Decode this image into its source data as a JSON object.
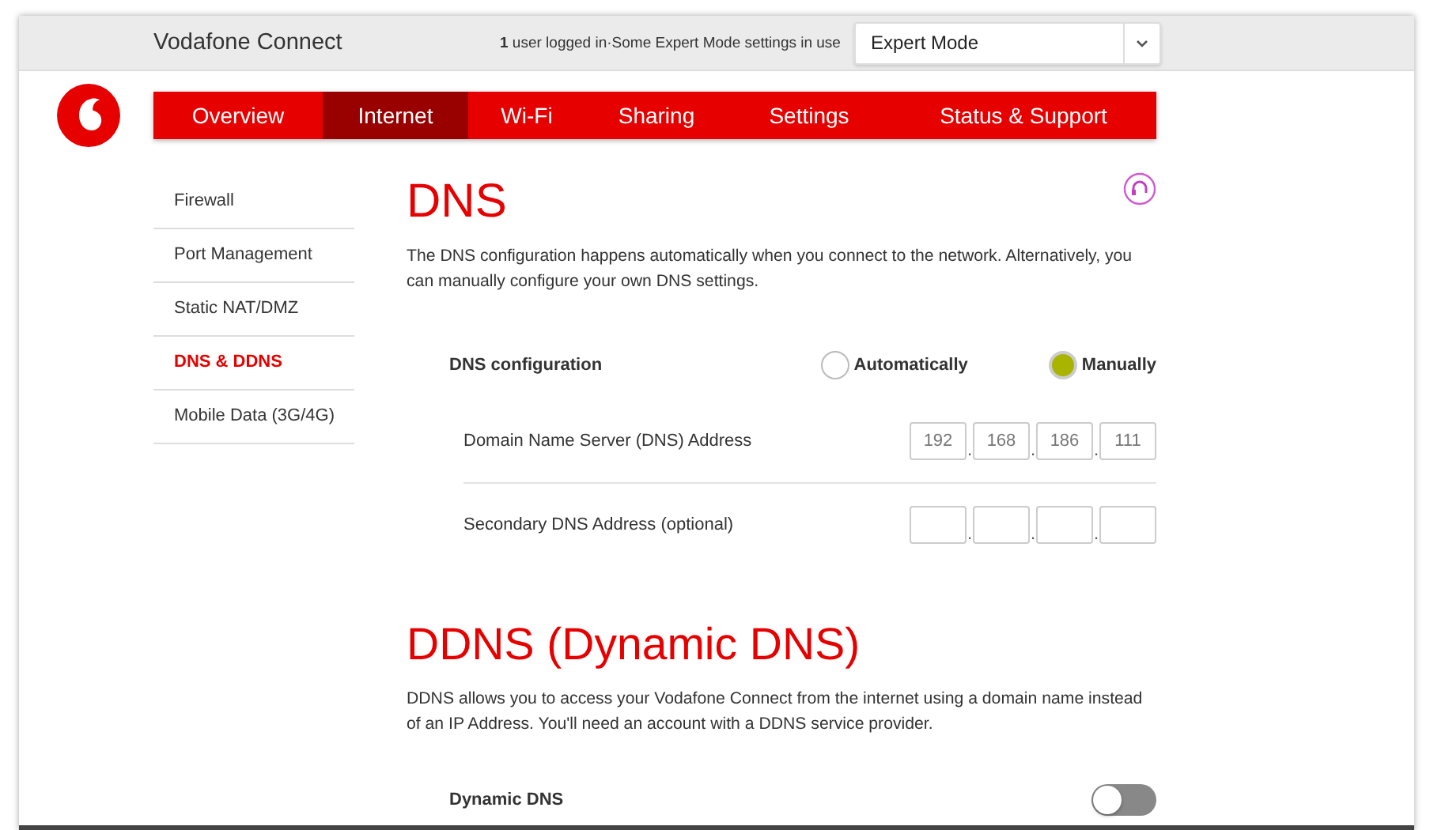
{
  "header": {
    "title": "Vodafone Connect",
    "status": "**1** user logged in·Some Expert Mode settings in use",
    "mode_select": {
      "value": "Expert Mode"
    }
  },
  "nav": {
    "tabs": [
      {
        "label": "Overview",
        "selected": false
      },
      {
        "label": "Internet",
        "selected": true
      },
      {
        "label": "Wi-Fi",
        "selected": false
      },
      {
        "label": "Sharing",
        "selected": false
      },
      {
        "label": "Settings",
        "selected": false
      },
      {
        "label": "Status & Support",
        "selected": false
      }
    ]
  },
  "sidebar": {
    "items": [
      {
        "label": "Firewall",
        "selected": false
      },
      {
        "label": "Port Management",
        "selected": false
      },
      {
        "label": "Static NAT/DMZ",
        "selected": false
      },
      {
        "label": "DNS & DDNS",
        "selected": true
      },
      {
        "label": "Mobile Data (3G/4G)",
        "selected": false
      }
    ]
  },
  "dns": {
    "title": "DNS",
    "description": "The DNS configuration happens automatically when you connect to the network. Alternatively, you can manually configure your own DNS settings.",
    "configuration": {
      "label": "DNS configuration",
      "options": [
        {
          "label": "Automatically",
          "selected": false
        },
        {
          "label": "Manually",
          "selected": true
        }
      ]
    },
    "fields": [
      {
        "label": "Domain Name Server (DNS) Address",
        "separator": ".",
        "octets": [
          "192",
          "168",
          "186",
          "111"
        ]
      },
      {
        "label": "Secondary DNS Address (optional)",
        "separator": "."
      }
    ]
  },
  "ddns": {
    "title": "DDNS (Dynamic DNS)",
    "description": "DDNS allows you to access your Vodafone Connect from the internet using a domain name instead of an IP Address. You'll need an account with a DDNS service provider.",
    "toggle": {
      "label": "Dynamic DNS",
      "on": false
    }
  }
}
